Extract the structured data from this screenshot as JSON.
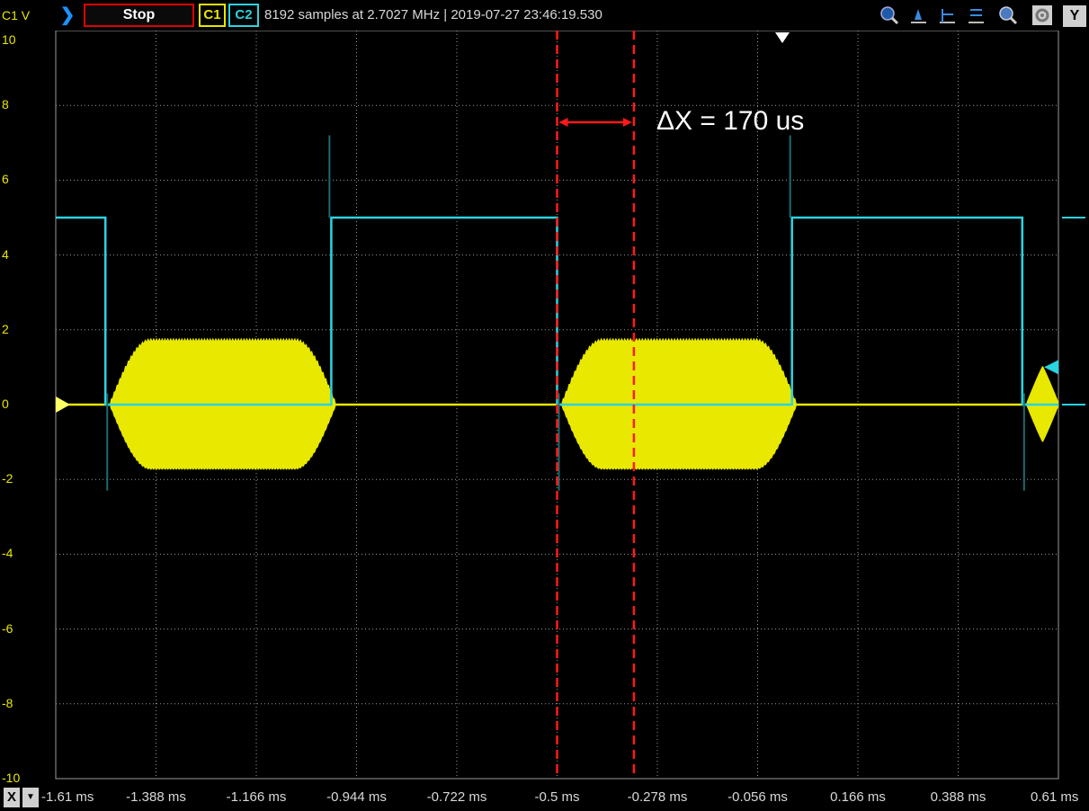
{
  "toolbar": {
    "channel_label": "C1 V",
    "stop_label": "Stop",
    "c1_label": "C1",
    "c2_label": "C2",
    "info": "8192 samples at 2.7027 MHz | 2019-07-27 23:46:19.530",
    "y_button": "Y",
    "icons": [
      "play-icon",
      "zoom-fit-icon",
      "cursor-y1-icon",
      "cursor-y2-icon",
      "cursor-y3-icon",
      "zoom-icon",
      "settings-icon"
    ]
  },
  "xaxis": {
    "x_button": "X",
    "dropdown": "▼",
    "ticks": [
      "-1.61 ms",
      "-1.388 ms",
      "-1.166 ms",
      "-0.944 ms",
      "-0.722 ms",
      "-0.5 ms",
      "-0.278 ms",
      "-0.056 ms",
      "0.166 ms",
      "0.388 ms",
      "0.61 ms"
    ]
  },
  "yaxis": {
    "ticks": [
      "10",
      "8",
      "6",
      "4",
      "2",
      "0",
      "-2",
      "-4",
      "-6",
      "-8",
      "-10"
    ]
  },
  "annotation": {
    "text": "ΔX = 170 us",
    "color": "#ff1a1a"
  },
  "colors": {
    "c1": "#e8e800",
    "c2": "#2ad4e0",
    "grid": "#9a9a9a",
    "marker": "#ff1a1a"
  },
  "chart_data": {
    "type": "line",
    "xlim": [
      -1.61,
      0.61
    ],
    "ylim": [
      -10,
      10
    ],
    "x_unit": "ms",
    "y_unit": "V",
    "series": [
      {
        "name": "C2",
        "segments": [
          [
            -1.61,
            5
          ],
          [
            -1.5,
            5
          ],
          [
            -1.5,
            0
          ],
          [
            -1.0,
            0
          ],
          [
            -1.0,
            5
          ],
          [
            -0.5,
            5
          ],
          [
            -0.5,
            0
          ],
          [
            0.02,
            0
          ],
          [
            0.02,
            5
          ],
          [
            0.53,
            5
          ],
          [
            0.53,
            0
          ],
          [
            0.61,
            0
          ]
        ]
      },
      {
        "name": "C1",
        "bursts": [
          [
            -1.49,
            -0.99
          ],
          [
            -0.49,
            0.03
          ],
          [
            0.54,
            0.61
          ]
        ],
        "amplitude": 1.7
      }
    ],
    "cursors": [
      -0.5,
      -0.33
    ]
  }
}
